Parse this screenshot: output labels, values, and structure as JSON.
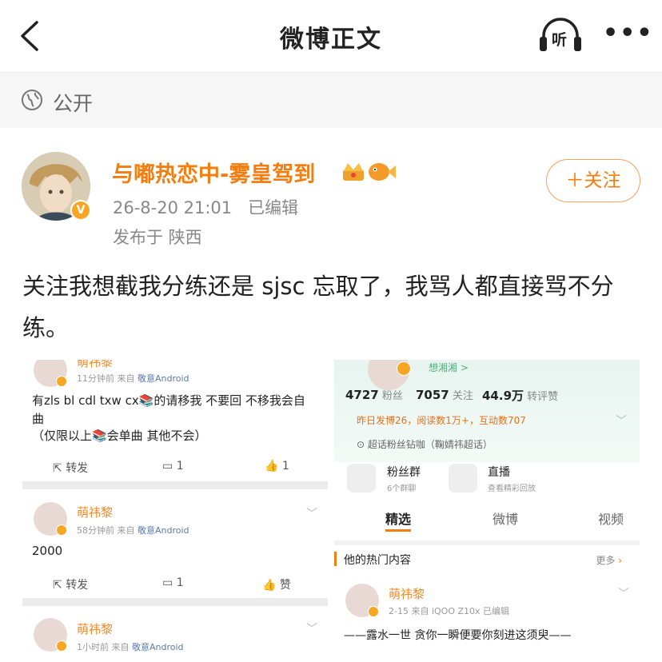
{
  "nav": {
    "back_icon": "chevron-left-icon",
    "title": "微博正文",
    "listen_label": "听",
    "more_icon": "more-dots-icon"
  },
  "visibility": {
    "icon": "globe-icon",
    "label": "公开"
  },
  "author": {
    "name": "与嘟热恋中-雾皇驾到",
    "badges": [
      "crown-icon",
      "fish-icon"
    ],
    "date": "26-8-20 21:01",
    "edited": "已编辑",
    "location": "发布于 陕西",
    "verified_icon": "v-badge-icon"
  },
  "follow_button": {
    "label": "＋关注",
    "color": "#f57c0e"
  },
  "post_text": "关注我想截我分练还是 sjsc 忘取了，我骂人都直接骂不分练。",
  "left_screenshot": {
    "comments": [
      {
        "name": "萌祎黎",
        "meta_time": "11分钟前",
        "meta_from": "来自",
        "meta_source": "敬意Android",
        "text": "有zls bl cdl txw cx📚的请移我 不要回 不移我会自曲",
        "text2": "（仅限以上📚会单曲 其他不会）",
        "repost": "转发",
        "comments": "1",
        "likes": "1"
      },
      {
        "name": "萌祎黎",
        "meta_time": "58分钟前",
        "meta_from": "来自",
        "meta_source": "敬意Android",
        "text": "2000",
        "repost": "转发",
        "comments": "1",
        "likes": "赞"
      },
      {
        "name": "萌祎黎",
        "meta_time": "1小时前",
        "meta_from": "来自",
        "meta_source": "敬意Android"
      }
    ]
  },
  "right_screenshot": {
    "top_name": "想湘湘 >",
    "stats": [
      {
        "value": "4727",
        "label": "粉丝"
      },
      {
        "value": "7057",
        "label": "关注"
      },
      {
        "value": "44.9万",
        "label": "转评赞"
      }
    ],
    "yesterday": "昨日发博26，阅读数1万+，互动数707",
    "super_topic": "超话粉丝钻咖（鞠婧祎超话）",
    "cards": [
      {
        "title": "粉丝群",
        "sub": "6个群聊",
        "icon": "people-icon"
      },
      {
        "title": "直播",
        "sub": "查看精彩回放",
        "icon": "tv-icon"
      }
    ],
    "tabs": [
      "精选",
      "微博",
      "视频"
    ],
    "hot_title": "他的热门内容",
    "hot_more": "更多",
    "post": {
      "name": "萌祎黎",
      "meta": "2-15  来自 iQOO Z10x  已编辑",
      "text": "——露水一世 贪你一瞬便要你刻进这须臾——"
    }
  },
  "colors": {
    "accent": "#f57c0e",
    "grey_text": "#888888",
    "visibility_bg": "#f6f6f6"
  }
}
